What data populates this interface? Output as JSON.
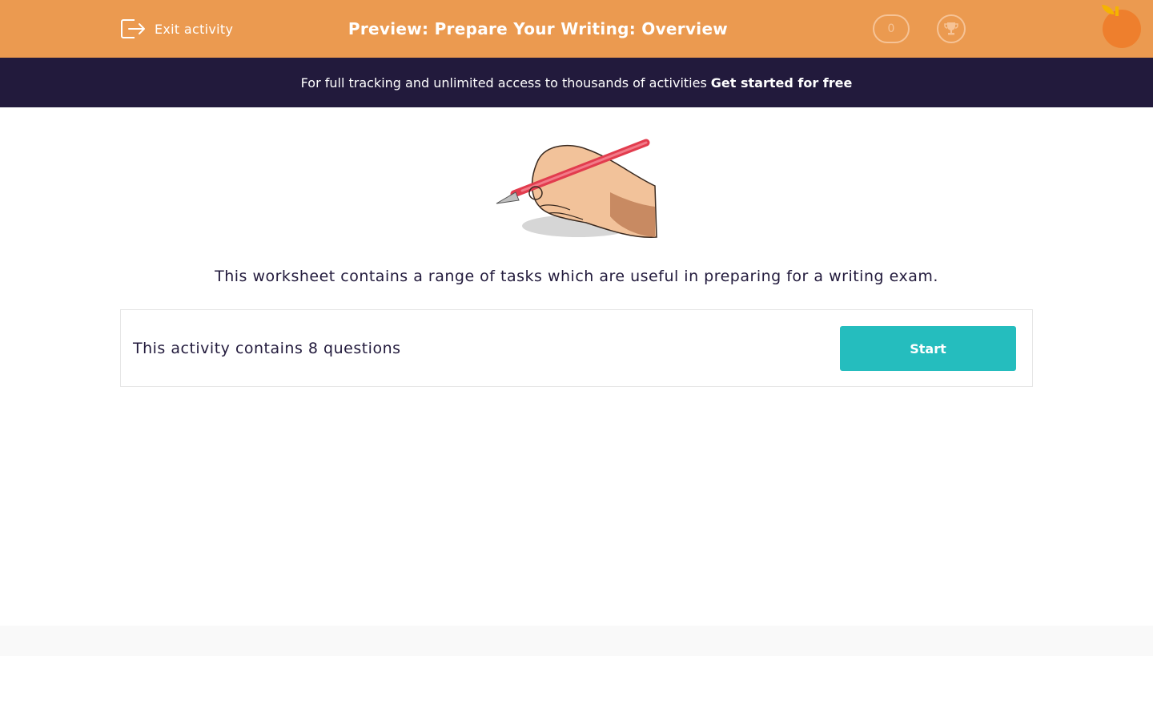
{
  "header": {
    "exit_label": "Exit activity",
    "title": "Preview: Prepare Your Writing: Overview",
    "score": "0"
  },
  "banner": {
    "text": "For full tracking and unlimited access to thousands of activities",
    "cta": "Get started for free"
  },
  "main": {
    "description": "This worksheet contains a range of tasks which are useful in preparing for a writing exam.",
    "question_count_text": "This activity contains 8 questions",
    "start_label": "Start"
  },
  "colors": {
    "header_bg": "#eb9a50",
    "banner_bg": "#221a3c",
    "accent": "#25bdbe",
    "text": "#221a3c"
  },
  "icons": {
    "exit": "exit-icon",
    "trophy": "trophy-icon",
    "logo": "orange-logo",
    "hero": "hand-writing-illustration"
  }
}
